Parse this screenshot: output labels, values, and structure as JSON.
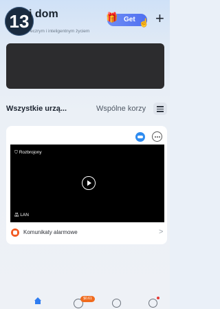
{
  "header": {
    "step_number": "13",
    "title": "i dom",
    "subtitle": "eczrym i inteligentnym życiem",
    "get_label": "Get"
  },
  "tabs": {
    "all_devices": "Wszystkie urzą...",
    "shared": "Wspólne korzy"
  },
  "device_card": {
    "status": "Rozbrojony",
    "connection": "LAN",
    "alarm_messages": "Komunikaty alarmowe"
  },
  "bottom_nav": {
    "promo_badge": "$0.61"
  },
  "colors": {
    "accent": "#2f7cf0",
    "alarm": "#f25a22",
    "get_button": "#5b7cf2"
  }
}
